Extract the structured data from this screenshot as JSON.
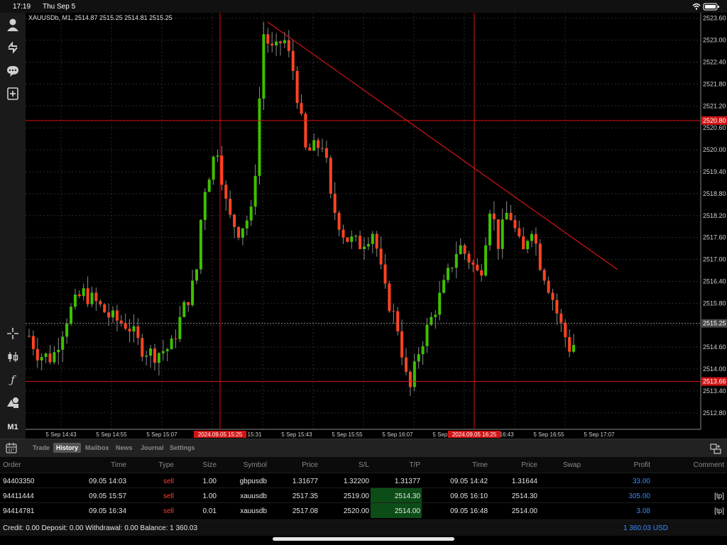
{
  "status": {
    "time": "17:19",
    "date": "Thu Sep 5"
  },
  "chart": {
    "header": "XAUUSDb, M1, 2514.87 2515.25 2514.81 2515.25",
    "price_labels": [
      "2523.60",
      "2523.00",
      "2522.40",
      "2521.80",
      "2521.20",
      "2520.60",
      "2520.00",
      "2519.40",
      "2518.80",
      "2518.20",
      "2517.60",
      "2517.00",
      "2516.40",
      "2515.80",
      "2515.20",
      "2514.60",
      "2514.00",
      "2513.40",
      "2512.80"
    ],
    "time_labels": [
      "5 Sep 14:43",
      "5 Sep 14:55",
      "5 Sep 15:07",
      "5 Sep 15:31",
      "5 Sep 15:43",
      "5 Sep 15:55",
      "5 Sep 16:07",
      "5 Sep 16:31",
      "5 Sep 16:43",
      "5 Sep 16:55",
      "5 Sep 17:07"
    ],
    "hline_high": "2520.80",
    "hline_current": "2515.25",
    "hline_low": "2513.66",
    "vline1_label": "2024.09.05 15:25",
    "vline2_label": "2024.09.05 16:25",
    "colors": {
      "bull": "#3fc000",
      "bear": "#ff4422",
      "line": "#d21414"
    }
  },
  "toolbar": {
    "timeframe": "M1"
  },
  "tabs": [
    "Trade",
    "History",
    "Mailbox",
    "News",
    "Journal",
    "Settings"
  ],
  "active_tab": "History",
  "columns": {
    "order": "Order",
    "time": "Time",
    "type": "Type",
    "size": "Size",
    "symbol": "Symbol",
    "price": "Price",
    "sl": "S/L",
    "tp": "T/P",
    "time2": "Time",
    "price2": "Price",
    "swap": "Swap",
    "profit": "Profit",
    "comment": "Comment"
  },
  "rows": [
    {
      "order": "94403350",
      "time": "09.05 14:03",
      "type": "sell",
      "size": "1.00",
      "symbol": "gbpusdb",
      "price": "1.31677",
      "sl": "1.32200",
      "tp": "1.31377",
      "time2": "09.05 14:42",
      "price2": "1.31644",
      "swap": "",
      "profit": "33.00",
      "comment": ""
    },
    {
      "order": "94411444",
      "time": "09.05 15:57",
      "type": "sell",
      "size": "1.00",
      "symbol": "xauusdb",
      "price": "2517.35",
      "sl": "2519.00",
      "tp": "2514.30",
      "time2": "09.05 16:10",
      "price2": "2514.30",
      "swap": "",
      "profit": "305.00",
      "comment": "[tp]"
    },
    {
      "order": "94414781",
      "time": "09.05 16:34",
      "type": "sell",
      "size": "0.01",
      "symbol": "xauusdb",
      "price": "2517.08",
      "sl": "2520.00",
      "tp": "2514.00",
      "time2": "09.05 16:48",
      "price2": "2514.00",
      "swap": "",
      "profit": "3.08",
      "comment": "[tp]"
    }
  ],
  "footer": {
    "balance": "Credit: 0.00  Deposit: 0.00  Withdrawal: 0.00  Balance: 1 360.03",
    "total": "1 360.03  USD"
  }
}
